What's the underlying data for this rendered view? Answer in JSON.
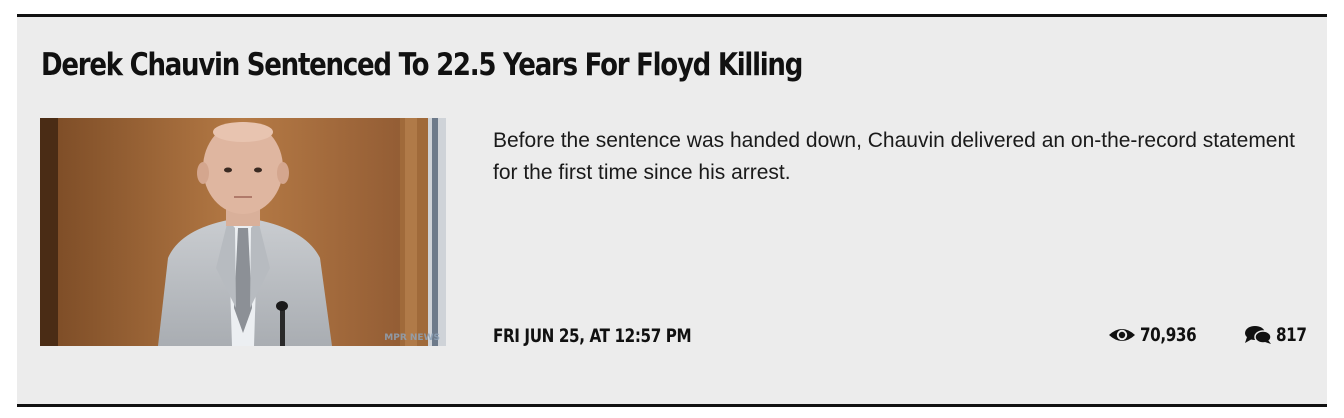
{
  "article": {
    "headline": "Derek Chauvin Sentenced To 22.5 Years For Floyd Killing",
    "summary": "Before the sentence was handed down, Chauvin delivered an on-the-record statement for the first time since his arrest.",
    "date": "FRI JUN 25, AT 12:57 PM",
    "views": "70,936",
    "comments": "817",
    "thumbnail_watermark": "MPR NEWS"
  },
  "icons": {
    "views": "eye-icon",
    "comments": "comment-bubbles-icon"
  },
  "colors": {
    "card_background": "#ececec",
    "rule": "#111111",
    "text": "#111111"
  }
}
